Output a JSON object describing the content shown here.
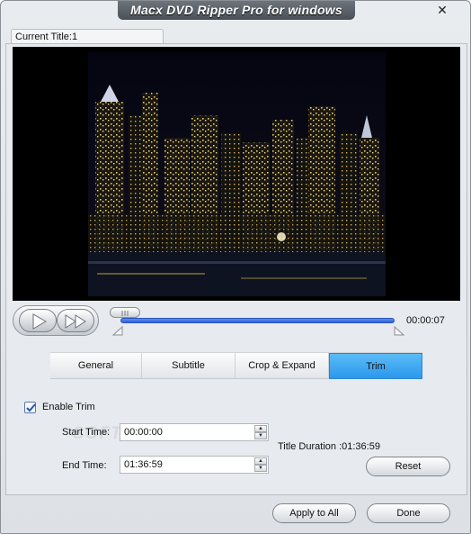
{
  "window": {
    "title": "Macx DVD Ripper Pro for windows",
    "close_icon": "close-icon"
  },
  "preview": {
    "current_title_label": "Current Title:1"
  },
  "player": {
    "time": "00:00:07",
    "play_icon": "play-icon",
    "fast_forward_icon": "fast-forward-icon",
    "progress_fraction": 0.015
  },
  "tabs": [
    {
      "label": "General",
      "active": false
    },
    {
      "label": "Subtitle",
      "active": false
    },
    {
      "label": "Crop & Expand",
      "active": false
    },
    {
      "label": "Trim",
      "active": true
    }
  ],
  "trim": {
    "enable_label": "Enable Trim",
    "enabled": true,
    "start_label": "Start Time:",
    "start_value": "00:00:00",
    "end_label": "End Time:",
    "end_value": "01:36:59",
    "duration_text": "Title Duration :01:36:59",
    "reset_label": "Reset"
  },
  "footer": {
    "apply_all_label": "Apply to All",
    "done_label": "Done"
  },
  "colors": {
    "accent_tab": "#2b98ec",
    "slider": "#2f61d6",
    "title_bar": "#4a5057"
  }
}
